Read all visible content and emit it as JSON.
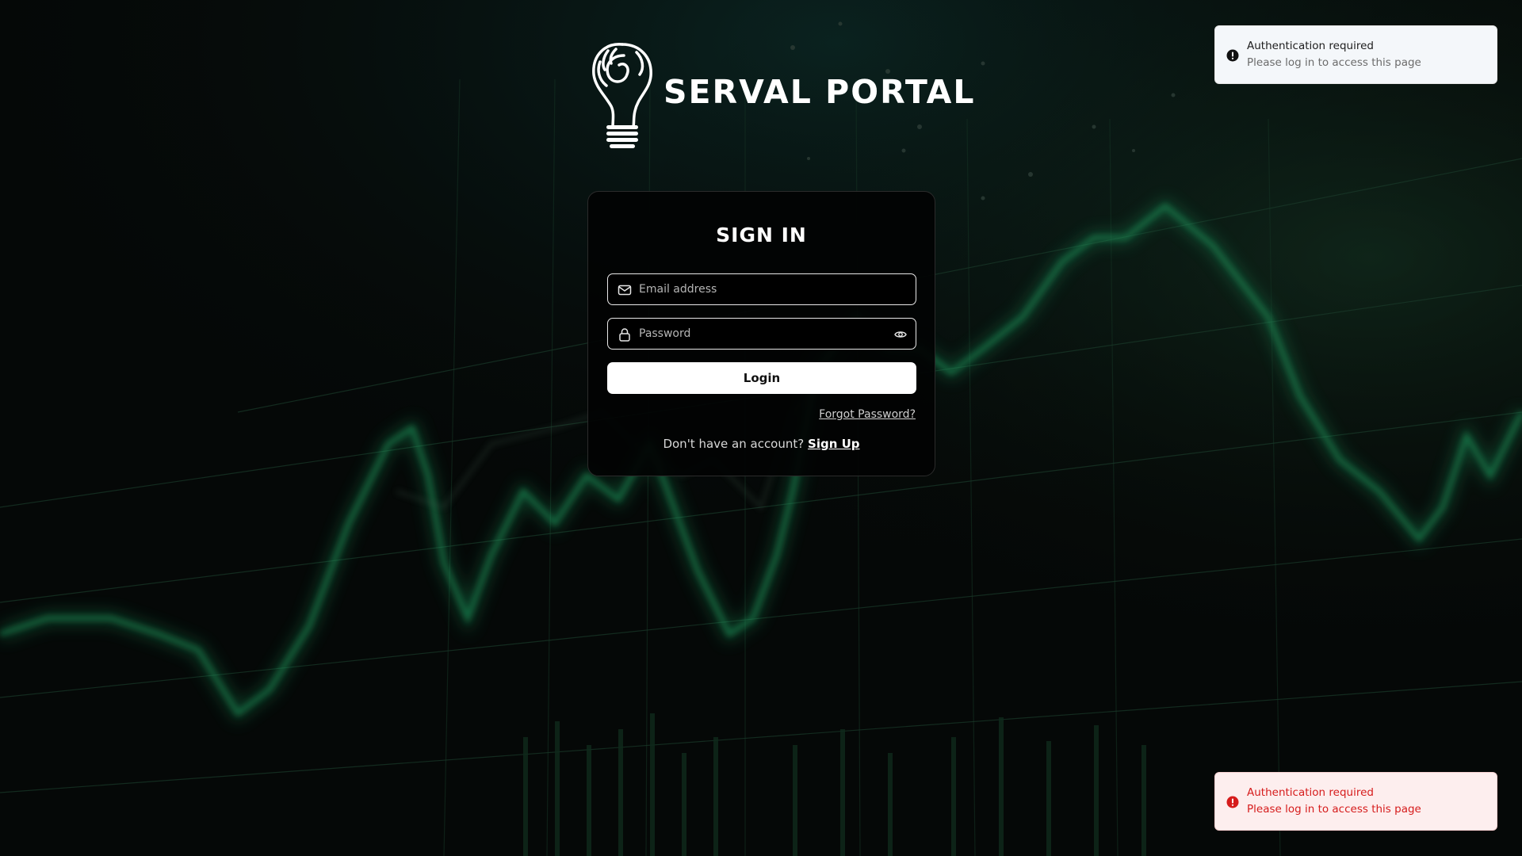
{
  "brand": {
    "name": "SERVAL PORTAL"
  },
  "signin": {
    "title": "SIGN IN",
    "email_placeholder": "Email address",
    "password_placeholder": "Password",
    "login_label": "Login",
    "forgot_label": "Forgot Password?",
    "no_account_text": "Don't have an account?",
    "signup_label": "Sign Up"
  },
  "toasts": [
    {
      "variant": "info",
      "title": "Authentication required",
      "description": "Please log in to access this page"
    },
    {
      "variant": "error",
      "title": "Authentication required",
      "description": "Please log in to access this page"
    }
  ],
  "colors": {
    "background": "#050807",
    "chart_green": "#1f9b5e",
    "error": "#d61c1c",
    "button_bg": "#ffffff"
  },
  "icons": {
    "email": "mail-icon",
    "password": "lock-icon",
    "visibility": "eye-icon",
    "toast": "alert-circle-icon",
    "logo": "lightbulb-swirl-icon"
  }
}
